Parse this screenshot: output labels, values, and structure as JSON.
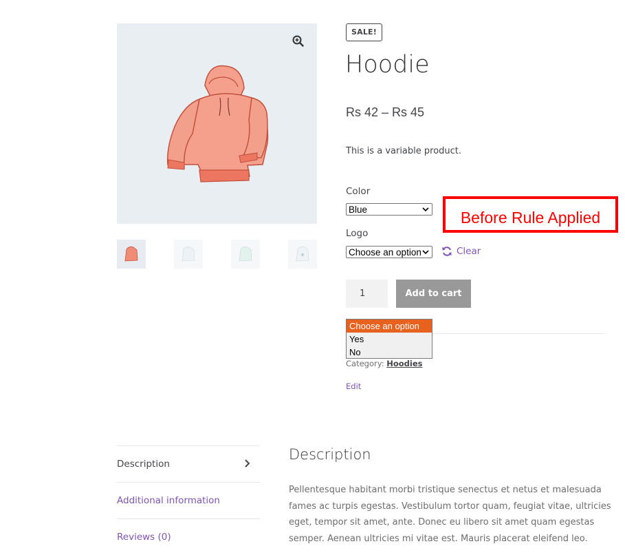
{
  "product": {
    "sale_badge": "SALE!",
    "title": "Hoodie",
    "price": "Rs 42 – Rs 45",
    "short_description": "This is a variable product."
  },
  "gallery": {
    "main_image_icon": "hoodie-image",
    "zoom_icon": "magnifier-plus-icon",
    "thumbnails": [
      "hoodie-red-thumb",
      "hoodie-blue-thumb",
      "hoodie-green-thumb",
      "hoodie-logo-thumb"
    ],
    "main_color": "#f4a08c"
  },
  "variations": {
    "color_label": "Color",
    "color_value": "Blue",
    "logo_label": "Logo",
    "logo_value": "Choose an option",
    "clear_label": "Clear",
    "clear_icon": "refresh-icon"
  },
  "annotation": {
    "text": "Before Rule Applied",
    "color": "#ff0000"
  },
  "cart": {
    "quantity": "1",
    "add_to_cart_label": "Add to cart"
  },
  "dropdown": {
    "options": [
      "Choose an option",
      "Yes",
      "No"
    ],
    "selected_index": 0,
    "highlight_color": "#e8621f"
  },
  "meta": {
    "category_label": "Category:",
    "category_value": "Hoodies",
    "edit_label": "Edit"
  },
  "tabs": {
    "items": [
      "Description",
      "Additional information",
      "Reviews (0)"
    ],
    "active_index": 0
  },
  "description": {
    "heading": "Description",
    "text": "Pellentesque habitant morbi tristique senectus et netus et malesuada fames ac turpis egestas. Vestibulum tortor quam, feugiat vitae, ultricies eget, tempor sit amet, ante. Donec eu libero sit amet quam egestas semper. Aenean ultricies mi vitae est. Mauris placerat eleifend leo."
  },
  "colors": {
    "accent_purple": "#7f54b3",
    "button_gray": "#999999",
    "text": "#43454b"
  }
}
